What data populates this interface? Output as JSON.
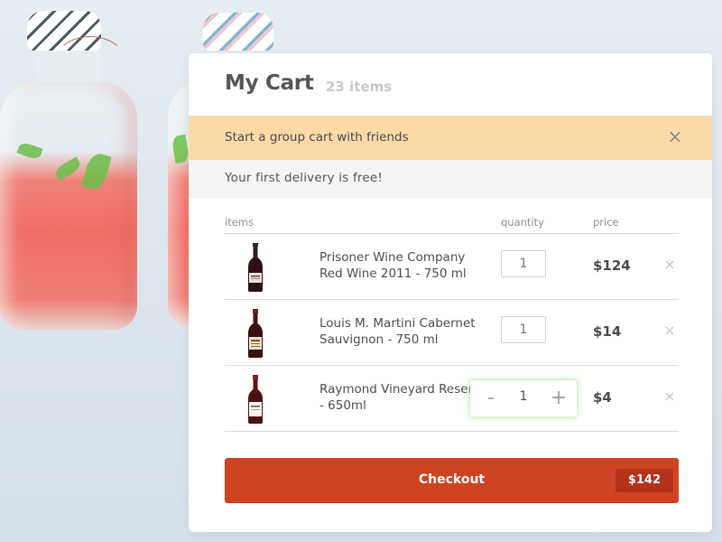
{
  "cart": {
    "title": "My Cart",
    "item_count": "23 items"
  },
  "promo": {
    "text": "Start a group cart with friends",
    "close_icon": "×"
  },
  "delivery": {
    "text": "Your first delivery is free!"
  },
  "table": {
    "headers": {
      "items": "items",
      "quantity": "quantity",
      "price": "price"
    },
    "rows": [
      {
        "name": "Prisoner Wine Company Red Wine 2011 - 750 ml",
        "quantity": "1",
        "price": "$124",
        "remove_icon": "×",
        "image_icon": "wine-bottle-icon"
      },
      {
        "name": "Louis M. Martini Cabernet Sauvignon - 750 ml",
        "quantity": "1",
        "price": "$14",
        "remove_icon": "×",
        "image_icon": "wine-bottle-icon"
      },
      {
        "name": "Raymond Vineyard Reserve - 650ml",
        "quantity": "1",
        "price": "$4",
        "remove_icon": "×",
        "image_icon": "wine-bottle-icon",
        "stepper": {
          "minus": "-",
          "plus": "+"
        }
      }
    ]
  },
  "checkout": {
    "label": "Checkout",
    "total": "$142"
  },
  "colors": {
    "accent": "#cf4322",
    "accent_dark": "#b5311a",
    "promo_bg": "#fdd9a8",
    "delivery_bg": "#f4f4f4",
    "stepper_glow": "#aadc8c"
  }
}
